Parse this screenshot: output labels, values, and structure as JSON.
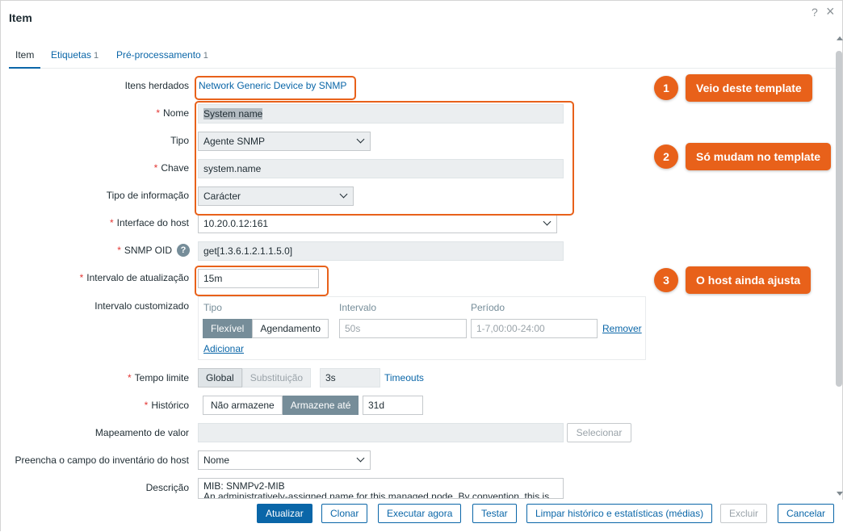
{
  "dialog": {
    "title": "Item",
    "help_icon": "?",
    "close_icon": "×"
  },
  "tabs": [
    {
      "label": "Item",
      "count": ""
    },
    {
      "label": "Etiquetas",
      "count": "1"
    },
    {
      "label": "Pré-processamento",
      "count": "1"
    }
  ],
  "form": {
    "inherited": {
      "label": "Itens herdados",
      "value": "Network Generic Device by SNMP"
    },
    "name": {
      "label": "Nome",
      "value": "System name"
    },
    "type": {
      "label": "Tipo",
      "value": "Agente SNMP"
    },
    "key": {
      "label": "Chave",
      "value": "system.name"
    },
    "info_type": {
      "label": "Tipo de informação",
      "value": "Carácter"
    },
    "host_interface": {
      "label": "Interface do host",
      "value": "10.20.0.12:161"
    },
    "snmp_oid": {
      "label": "SNMP OID",
      "value": "get[1.3.6.1.2.1.1.5.0]",
      "help": "?"
    },
    "update_interval": {
      "label": "Intervalo de atualização",
      "value": "15m"
    },
    "custom_interval": {
      "label": "Intervalo customizado",
      "col_type": "Tipo",
      "col_interval": "Intervalo",
      "col_period": "Período",
      "opt_flexible": "Flexível",
      "opt_scheduling": "Agendamento",
      "interval_value": "50s",
      "period_value": "1-7,00:00-24:00",
      "remove": "Remover",
      "add": "Adicionar"
    },
    "timeout": {
      "label": "Tempo limite",
      "opt_global": "Global",
      "opt_override": "Substituição",
      "value": "3s",
      "link": "Timeouts"
    },
    "history": {
      "label": "Histórico",
      "opt_no_store": "Não armazene",
      "opt_store": "Armazene até",
      "value": "31d"
    },
    "value_map": {
      "label": "Mapeamento de valor",
      "value": "",
      "select": "Selecionar"
    },
    "inventory": {
      "label": "Preencha o campo do inventário do host",
      "value": "Nome"
    },
    "description": {
      "label": "Descrição",
      "line1": "MIB: SNMPv2-MIB",
      "line2": "An administratively-assigned name for this managed node. By convention, this is"
    }
  },
  "callouts": [
    {
      "num": "1",
      "text": "Veio deste template"
    },
    {
      "num": "2",
      "text": "Só mudam no template"
    },
    {
      "num": "3",
      "text": "O host ainda ajusta"
    }
  ],
  "buttons": {
    "update": "Atualizar",
    "clone": "Clonar",
    "execute": "Executar agora",
    "test": "Testar",
    "clear": "Limpar histórico e estatísticas (médias)",
    "delete": "Excluir",
    "cancel": "Cancelar"
  },
  "colors": {
    "accent": "#0a66a8",
    "callout": "#e8611a",
    "required": "#e33734"
  }
}
